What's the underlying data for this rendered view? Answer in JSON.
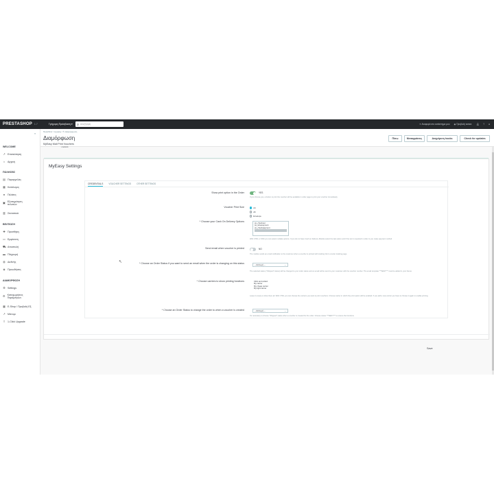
{
  "topbar": {
    "logo": "PRESTASHOP",
    "version": "1.7",
    "quick_access": "Γρήγορη Πρόσβαση ▾",
    "search_placeholder": "Αναζήτηση",
    "shop_link": "Αναφορά στο κατάστημα μου",
    "view_shop": "Προβολή κατασ.",
    "icons": [
      "bell-icon",
      "help-icon",
      "user-icon"
    ]
  },
  "sidebar": {
    "sections": [
      {
        "title": "WELCOME",
        "items": [
          {
            "label": "Επισκόπηση",
            "icon": "trend-icon"
          },
          {
            "label": "Αρχική",
            "icon": "home-icon"
          }
        ]
      },
      {
        "title": "ΠΩΛΗΣΕΙΣ",
        "items": [
          {
            "label": "Παραγγελίες",
            "icon": "inbox-icon"
          },
          {
            "label": "Κατάλογος",
            "icon": "store-icon"
          },
          {
            "label": "Πελάτες",
            "icon": "user-icon"
          },
          {
            "label": "Εξυπηρέτηση πελατών",
            "icon": "chat-icon"
          },
          {
            "label": "Στατιστικά",
            "icon": "chart-icon"
          }
        ]
      },
      {
        "title": "ΒΕΛΤΙΩΣΗ",
        "items": [
          {
            "label": "Προσθήκη",
            "icon": "puzzle-icon"
          },
          {
            "label": "Εμφάνιση",
            "icon": "desktop-icon"
          },
          {
            "label": "Αποστολή",
            "icon": "truck-icon"
          },
          {
            "label": "Πληρωμή",
            "icon": "card-icon"
          },
          {
            "label": "Διεθνής",
            "icon": "globe-icon"
          },
          {
            "label": "Προωθήσεις",
            "icon": "tag-icon"
          }
        ]
      },
      {
        "title": "ΔΙΑΜΟΡΦΩΣΗ",
        "items": [
          {
            "label": "Settings",
            "icon": "gear-icon"
          },
          {
            "label": "Καταχωρήσεις Παραμέτρων",
            "icon": "settings-icon"
          },
          {
            "label": "E-Shop / Προβολή Εξ.",
            "icon": "grid-icon"
          },
          {
            "label": "Μάνυμι",
            "icon": "trend-icon"
          },
          {
            "label": "1-Click Upgrade",
            "icon": "upgrade-icon"
          }
        ]
      }
    ]
  },
  "header": {
    "breadcrumb": "Πρόσθετα  /  myeasy  /  ✎ Διαμόρφωση",
    "title": "Διαμόρφωση",
    "subtitle": "MyEasy Mail Print Vouchers",
    "list_item": "• Lorem",
    "buttons": [
      "Πίσω",
      "Μεταφράσεις",
      "Διαχείριση hooks",
      "Check for updates"
    ]
  },
  "panel": {
    "title": "MyEasy Settings",
    "tabs": [
      "CREDENTIALS",
      "VOUCHER SETTINGS",
      "OTHER SETTINGS"
    ],
    "active_tab": 0,
    "fields": {
      "show_print": {
        "label": "Show print option in the Order",
        "value": "YES",
        "help": "If you choose yes, a button to print the voucher will be available in order page to print your voucher immediately"
      },
      "voucher_size": {
        "label": "Voucher Print Size",
        "options": [
          "A4",
          "A6",
          "Envelope"
        ],
        "selected": 0
      },
      "cod_options": {
        "label": "* Choose your Cash On Delivery Options",
        "items": [
          "ps_checkout",
          "ps_wirepayment",
          "ps_checkpayment",
          "ps_cashondelivery"
        ],
        "help": "With CTRL or Shift you can select multiple options. If you do not have Cash on Delivery Module select the last option and if the text is required in order to you make payment method"
      },
      "send_email": {
        "label": "Send email when voucher is printed",
        "value": "NO",
        "help": "The module sends an email notification to the customer when a voucher is printed with tracking link to courier tracking page"
      },
      "order_status_email": {
        "label": "* Choose an Order Status if you want to send an email when the order is changing on this status",
        "value": "-- Επιλογή --",
        "help": "The selected status (\"Shipped\" status) will be changed to your order status and an email will be send to your customer with the voucher number. The email template ***SENT*** must be added in your theme"
      },
      "carriers": {
        "label": "* Choose carriers to show printing functions",
        "items": [
          "Click and collect",
          "My carrier",
          "My cheap carrier",
          "My light carrier"
        ],
        "help": "Leave it empty to show them all. With CTRL you can choose the carriers you want to print vouchers. Choose carrier in which the print option will be enabled. If you add a new carrier you have to choose it again to enable printing"
      },
      "voucher_created_status": {
        "label": "* Choose an Order Status to change the order to when a voucher is created",
        "value": "-- Επιλογή --",
        "help": "It's necessary to choose \"Shipped\" status when a voucher is created for the order. Choose status ***SENT*** to ensure the functions"
      }
    },
    "save_label": "Save"
  },
  "colors": {
    "topbar": "#25282b",
    "accent": "#25b9d7",
    "toggle_on": "#70b580"
  }
}
